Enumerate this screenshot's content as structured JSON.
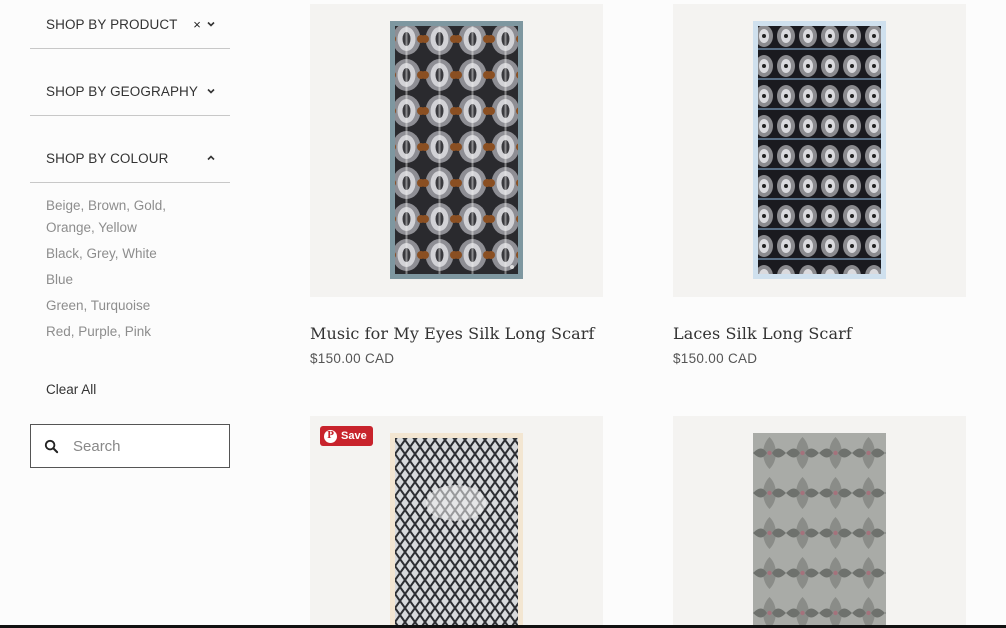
{
  "sidebar": {
    "filters": [
      {
        "label": "SHOP BY PRODUCT",
        "clear_icon": "close-icon",
        "chevron": "chevron-down-icon"
      },
      {
        "label": "SHOP BY GEOGRAPHY",
        "chevron": "chevron-down-icon"
      },
      {
        "label": "SHOP BY COLOUR",
        "chevron": "chevron-up-icon"
      }
    ],
    "colours": [
      "Beige, Brown, Gold, Orange, Yellow",
      "Black, Grey, White",
      "Blue",
      "Green, Turquoise",
      "Red, Purple, Pink"
    ],
    "clear_all": "Clear All",
    "search": {
      "placeholder": "Search",
      "value": ""
    }
  },
  "products": [
    {
      "title": "Music for My Eyes Silk Long Scarf",
      "price": "$150.00 CAD"
    },
    {
      "title": "Laces Silk Long Scarf",
      "price": "$150.00 CAD"
    },
    {
      "title": "",
      "price": ""
    },
    {
      "title": "",
      "price": ""
    }
  ],
  "pinterest": {
    "label": "Save"
  },
  "colors": {
    "pinterest_red": "#c8232c",
    "product_bg": "#f4f3f1"
  }
}
